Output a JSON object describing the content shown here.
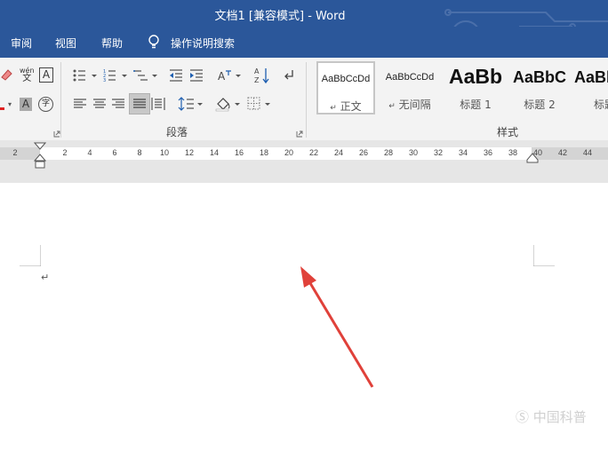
{
  "title_bar": {
    "title": "文档1 [兼容模式]  -  Word"
  },
  "menu_tabs": [
    {
      "label": "审阅"
    },
    {
      "label": "视图"
    },
    {
      "label": "帮助"
    },
    {
      "label": "操作说明搜索"
    }
  ],
  "ribbon": {
    "font_group": {
      "phonetic_top": "wén",
      "phonetic_bottom": "文",
      "char_border": "A",
      "char_shading": "A",
      "enclose_char": "字"
    },
    "paragraph_group": {
      "label": "段落"
    },
    "styles_group": {
      "label": "样式",
      "styles": [
        {
          "preview": "AaBbCcDd",
          "name": "正文",
          "selected": true
        },
        {
          "preview": "AaBbCcDd",
          "name": "无间隔",
          "selected": false
        },
        {
          "preview": "AaBb",
          "name": "标题 1",
          "selected": false
        },
        {
          "preview": "AaBbC",
          "name": "标题 2",
          "selected": false
        },
        {
          "preview": "AaBb",
          "name": "标题",
          "selected": false
        }
      ]
    }
  },
  "ruler": {
    "ticks": [
      "2",
      "2",
      "4",
      "6",
      "8",
      "10",
      "12",
      "14",
      "16",
      "18",
      "20",
      "22",
      "24",
      "26",
      "28",
      "30",
      "32",
      "34",
      "36",
      "38",
      "40",
      "42",
      "44"
    ]
  },
  "document": {
    "paragraph_mark": "↵"
  },
  "watermark": {
    "text": "Ⓢ 中国科普"
  },
  "colors": {
    "title_bar": "#2b579a",
    "ribbon": "#f3f3f3",
    "arrow": "#e0413a"
  }
}
